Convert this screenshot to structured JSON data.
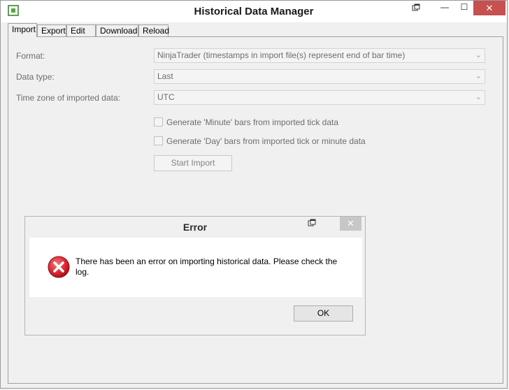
{
  "window": {
    "title": "Historical Data Manager",
    "controls": {
      "minimize": "—",
      "maximize": "☐",
      "close": "✕"
    }
  },
  "tabs": [
    {
      "label": "Import",
      "active": true
    },
    {
      "label": "Export"
    },
    {
      "label": "Edit"
    },
    {
      "label": "Download"
    },
    {
      "label": "Reload"
    }
  ],
  "form": {
    "format_label": "Format:",
    "format_value": "NinjaTrader (timestamps in import file(s) represent end of bar time)",
    "datatype_label": "Data type:",
    "datatype_value": "Last",
    "timezone_label": "Time zone of imported data:",
    "timezone_value": "UTC",
    "chk_minute": "Generate 'Minute' bars from imported tick data",
    "chk_day": "Generate 'Day' bars from imported tick or minute data",
    "start_import": "Start Import"
  },
  "dialog": {
    "title": "Error",
    "close": "✕",
    "message": "There has been an error on importing historical data. Please check the log.",
    "ok": "OK"
  },
  "colors": {
    "close_active": "#c75050",
    "error_red": "#d9232f"
  }
}
